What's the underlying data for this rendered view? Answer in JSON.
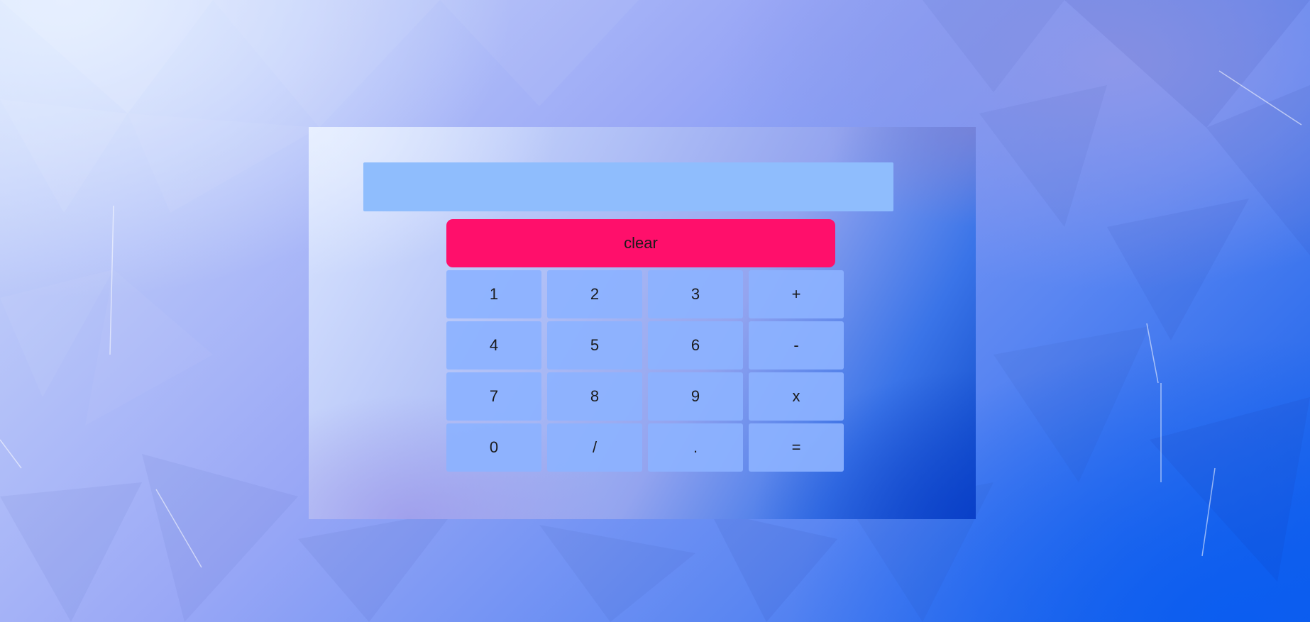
{
  "calculator": {
    "display_value": "",
    "clear_label": "clear",
    "keys": [
      {
        "label": "1",
        "name": "key-1"
      },
      {
        "label": "2",
        "name": "key-2"
      },
      {
        "label": "3",
        "name": "key-3"
      },
      {
        "label": "+",
        "name": "key-plus"
      },
      {
        "label": "4",
        "name": "key-4"
      },
      {
        "label": "5",
        "name": "key-5"
      },
      {
        "label": "6",
        "name": "key-6"
      },
      {
        "label": "-",
        "name": "key-minus"
      },
      {
        "label": "7",
        "name": "key-7"
      },
      {
        "label": "8",
        "name": "key-8"
      },
      {
        "label": "9",
        "name": "key-9"
      },
      {
        "label": "x",
        "name": "key-multiply"
      },
      {
        "label": "0",
        "name": "key-0"
      },
      {
        "label": "/",
        "name": "key-divide"
      },
      {
        "label": ".",
        "name": "key-decimal"
      },
      {
        "label": "=",
        "name": "key-equals"
      }
    ]
  },
  "colors": {
    "display_bg": "#8fbdfd",
    "clear_bg": "#ff0f6b",
    "key_bg": "#8cb2ff"
  }
}
